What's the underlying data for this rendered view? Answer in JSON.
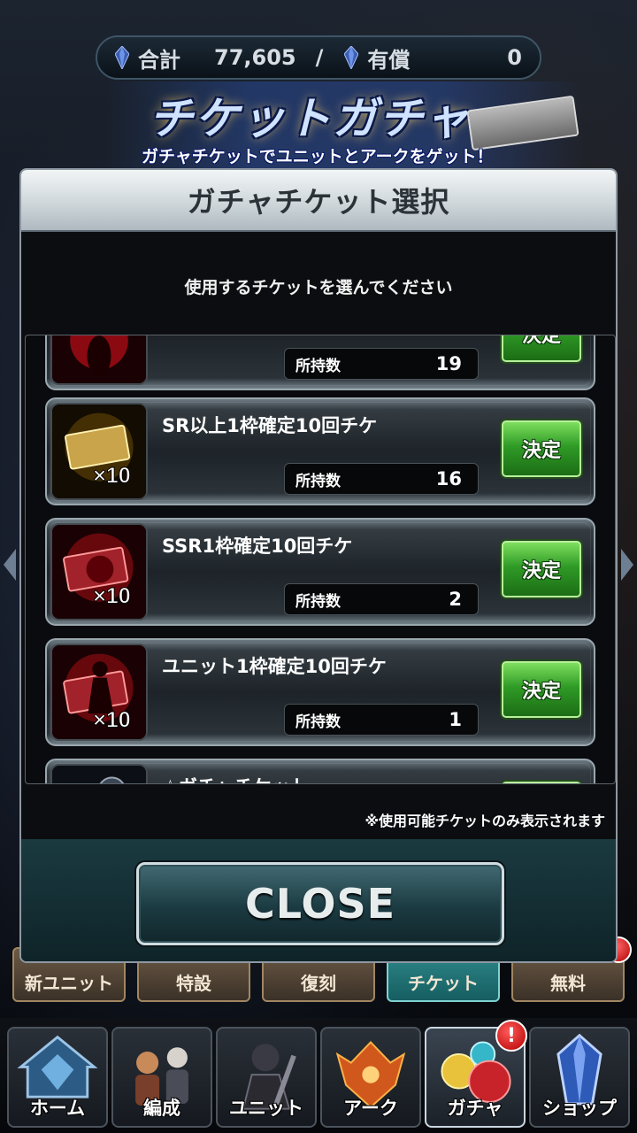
{
  "currency": {
    "total_label": "合計",
    "total_value": "77,605",
    "separator": "/",
    "paid_label": "有償",
    "paid_value": "0"
  },
  "banner": {
    "title": "チケットガチャ",
    "subtitle": "ガチャチケットでユニットとアークをゲット！"
  },
  "modal": {
    "title": "ガチャチケット選択",
    "instruction": "使用するチケットを選んでください",
    "count_label": "所持数",
    "decide_label": "決定",
    "tickets": [
      {
        "name": "",
        "count": "19",
        "icon": "red-unit-ticket-icon"
      },
      {
        "name": "SR以上1枠確定10回チケ",
        "count": "16",
        "icon": "gold-ticket-x10-icon"
      },
      {
        "name": "SSR1枠確定10回チケ",
        "count": "2",
        "icon": "red-ticket-x10-icon"
      },
      {
        "name": "ユニット1枠確定10回チケ",
        "count": "1",
        "icon": "unit-ticket-x10-icon"
      },
      {
        "name": "☆ガチャチケット",
        "count": "",
        "icon": "star-ticket-icon"
      }
    ],
    "note": "※使用可能チケットのみ表示されます",
    "close_label": "CLOSE"
  },
  "subtabs": [
    "新ユニット",
    "特設",
    "復刻",
    "チケット",
    "無料"
  ],
  "bottom_nav": [
    {
      "label": "ホーム",
      "icon": "home-icon"
    },
    {
      "label": "編成",
      "icon": "party-icon"
    },
    {
      "label": "ユニット",
      "icon": "unit-icon"
    },
    {
      "label": "アーク",
      "icon": "ark-icon"
    },
    {
      "label": "ガチャ",
      "icon": "gacha-icon"
    },
    {
      "label": "ショップ",
      "icon": "shop-crystal-icon"
    }
  ],
  "gacha_badge": "!",
  "colors": {
    "decide_green": "#2f9b26",
    "modal_header": "#dfe5e8",
    "footer_teal": "#1a3a40",
    "badge_red": "#c40000"
  }
}
